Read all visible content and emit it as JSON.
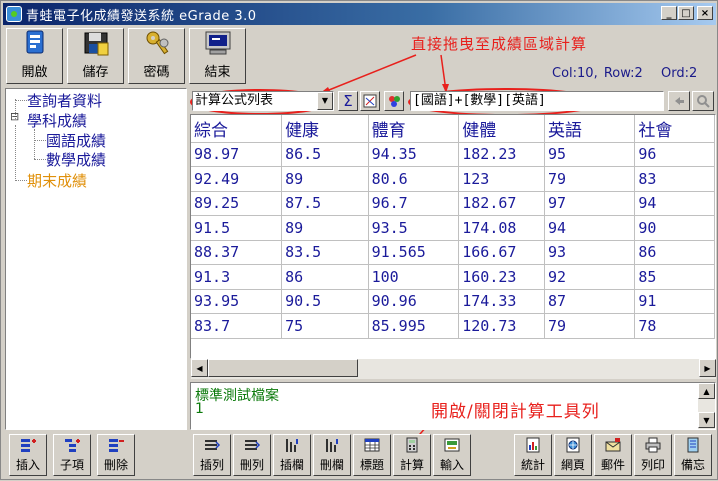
{
  "window": {
    "title": "青蛙電子化成績發送系統  eGrade 3.0",
    "controls": [
      "_",
      "□",
      "×"
    ]
  },
  "toolbar": {
    "open": "開啟",
    "save": "儲存",
    "password": "密碼",
    "exit": "結束"
  },
  "annotations": {
    "drag_hint": "直接拖曳至成績區域計算",
    "toggle_hint": "開啟/關閉計算工具列"
  },
  "status": {
    "col": "Col:10,",
    "row": "Row:2",
    "ord": "Ord:2"
  },
  "tree": {
    "items": [
      {
        "label": "查詢者資料",
        "color": "#1a1a9a"
      },
      {
        "label": "學科成績",
        "color": "#1a1a9a"
      },
      {
        "label": "國語成績",
        "color": "#1a1a9a"
      },
      {
        "label": "數學成績",
        "color": "#1a1a9a"
      },
      {
        "label": "期末成績",
        "color": "#e0900a"
      }
    ],
    "expander": "⊟"
  },
  "formula_bar": {
    "combo_value": "計算公式列表",
    "sum_symbol": "Σ",
    "formula": "[國語]+[數學][英語]"
  },
  "grid": {
    "columns": [
      "綜合",
      "健康",
      "體育",
      "健體",
      "英語",
      "社會"
    ],
    "rows": [
      [
        "98.97",
        "86.5",
        "94.35",
        "182.23",
        "95",
        "96"
      ],
      [
        "92.49",
        "89",
        "80.6",
        "123",
        "79",
        "83"
      ],
      [
        "89.25",
        "87.5",
        "96.7",
        "182.67",
        "97",
        "94"
      ],
      [
        "91.5",
        "89",
        "93.5",
        "174.08",
        "94",
        "90"
      ],
      [
        "88.37",
        "83.5",
        "91.565",
        "166.67",
        "93",
        "86"
      ],
      [
        "91.3",
        "86",
        "100",
        "160.23",
        "92",
        "85"
      ],
      [
        "93.95",
        "90.5",
        "90.96",
        "174.33",
        "87",
        "91"
      ],
      [
        "83.7",
        "75",
        "85.995",
        "120.73",
        "79",
        "78"
      ]
    ]
  },
  "memo": {
    "line1": "標準測試檔案",
    "line2": "1"
  },
  "left_buttons": {
    "insert": "插入",
    "child": "子項",
    "delete": "刪除"
  },
  "bottom_buttons": {
    "insert_row": "插列",
    "delete_row": "刪列",
    "insert_col": "插欄",
    "delete_col": "刪欄",
    "header": "標題",
    "calc": "計算",
    "input": "輸入",
    "stats": "統計",
    "web": "網頁",
    "mail": "郵件",
    "print": "列印",
    "memo": "備忘"
  },
  "colors": {
    "annotation": "#e8201c",
    "grid_text": "#1a1a9a",
    "memo_text": "#0b7a0b",
    "title_bar": "#0a246a"
  }
}
